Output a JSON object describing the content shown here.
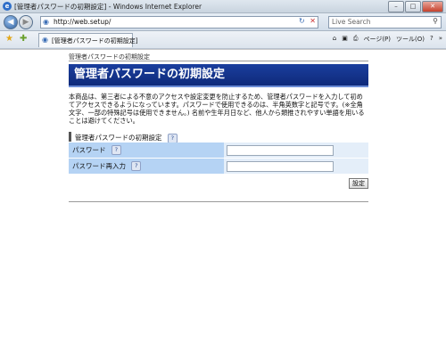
{
  "window": {
    "title": "[管理者パスワードの初期設定] - Windows Internet Explorer",
    "buttons": {
      "minimize": "–",
      "maximize": "□",
      "close": "✕"
    }
  },
  "nav": {
    "back": "◀",
    "forward": "▶",
    "url": "http://web.setup/",
    "refresh": "↻",
    "stop": "✕",
    "search_placeholder": "Live Search",
    "search_icon": "search-icon"
  },
  "cmdbar": {
    "tab_label": "[管理者パスワードの初期設定]",
    "home": "⌂",
    "feeds": "▣",
    "print": "⎙",
    "page": "ページ(P)",
    "tools": "ツール(O)",
    "help": "?",
    "more": "»"
  },
  "page": {
    "breadcrumb": "管理者パスワードの初期設定",
    "heading": "管理者パスワードの初期設定",
    "description": "本商品は、第三者による不意のアクセスや設定変更を防止するため、管理者パスワードを入力して初めてアクセスできるようになっています。パスワードで使用できるのは、半角英数字と記号です。(※全角文字、一部の特殊記号は使用できません。) 名前や生年月日など、他人から類推されやすい単語を用いることは避けてください。",
    "section_title": "管理者パスワードの初期設定",
    "help_glyph": "?",
    "fields": [
      {
        "label": "パスワード",
        "value": ""
      },
      {
        "label": "パスワード再入力",
        "value": ""
      }
    ],
    "submit": "設定"
  }
}
